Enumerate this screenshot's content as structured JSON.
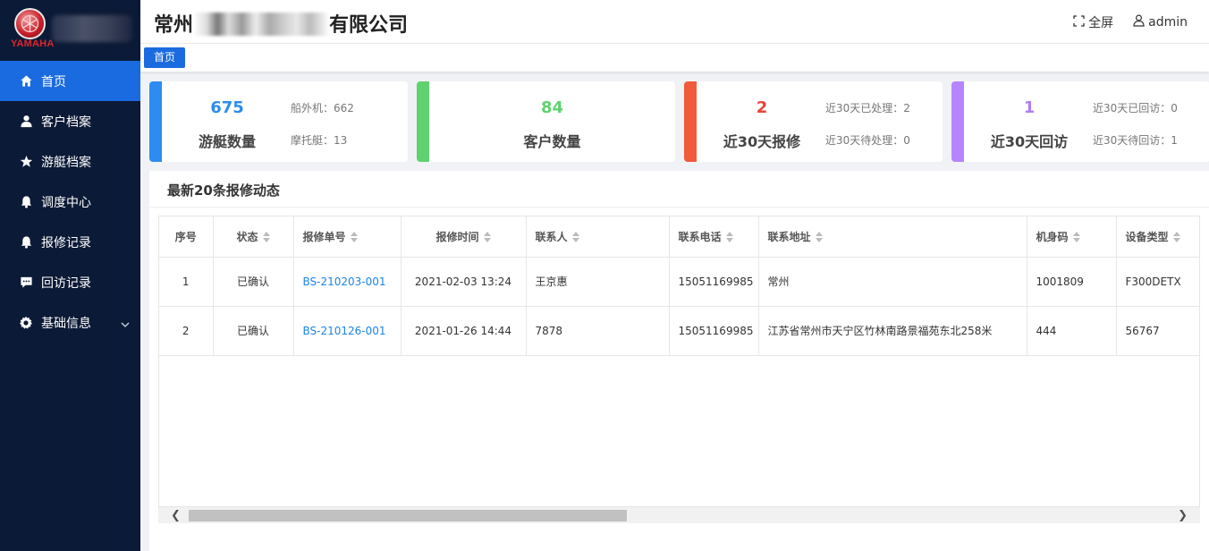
{
  "brand": {
    "logo_text": "YAMAHA"
  },
  "sidebar": {
    "items": [
      {
        "label": "首页",
        "icon": "home-icon",
        "active": true
      },
      {
        "label": "客户档案",
        "icon": "user-icon",
        "active": false
      },
      {
        "label": "游艇档案",
        "icon": "star-icon",
        "active": false
      },
      {
        "label": "调度中心",
        "icon": "bell-icon",
        "active": false
      },
      {
        "label": "报修记录",
        "icon": "bell-icon",
        "active": false
      },
      {
        "label": "回访记录",
        "icon": "chat-icon",
        "active": false
      },
      {
        "label": "基础信息",
        "icon": "gear-icon",
        "active": false
      }
    ]
  },
  "header": {
    "company_prefix": "常州",
    "company_suffix": "有限公司",
    "fullscreen_label": "全屏",
    "user_label": "admin"
  },
  "tabs": [
    {
      "label": "首页"
    }
  ],
  "cards": [
    {
      "value": "675",
      "label": "游艇数量",
      "sub1": "船外机：662",
      "sub2": "摩托艇：13",
      "color": "#2d8cf0",
      "value_color": "#2d8cf0"
    },
    {
      "value": "84",
      "label": "客户数量",
      "color": "#5fd16f",
      "value_color": "#5fd16f"
    },
    {
      "value": "2",
      "label": "近30天报修",
      "sub1": "近30天已处理：2",
      "sub2": "近30天待处理：0",
      "color": "#f25a3c",
      "value_color": "#e8443a"
    },
    {
      "value": "1",
      "label": "近30天回访",
      "sub1": "近30天已回访：0",
      "sub2": "近30天待回访：1",
      "color": "#b784ff",
      "value_color": "#b07df7"
    }
  ],
  "repairs": {
    "title": "最新20条报修动态",
    "columns": [
      "序号",
      "状态",
      "报修单号",
      "报修时间",
      "联系人",
      "联系电话",
      "联系地址",
      "机身码",
      "设备类型"
    ],
    "rows": [
      [
        "1",
        "已确认",
        "BS-210203-001",
        "2021-02-03 13:24",
        "王京惠",
        "15051169985",
        "常州",
        "1001809",
        "F300DETX"
      ],
      [
        "2",
        "已确认",
        "BS-210126-001",
        "2021-01-26 14:44",
        "7878",
        "15051169985",
        "江苏省常州市天宁区竹林南路景福苑东北258米",
        "444",
        "56767"
      ]
    ]
  }
}
